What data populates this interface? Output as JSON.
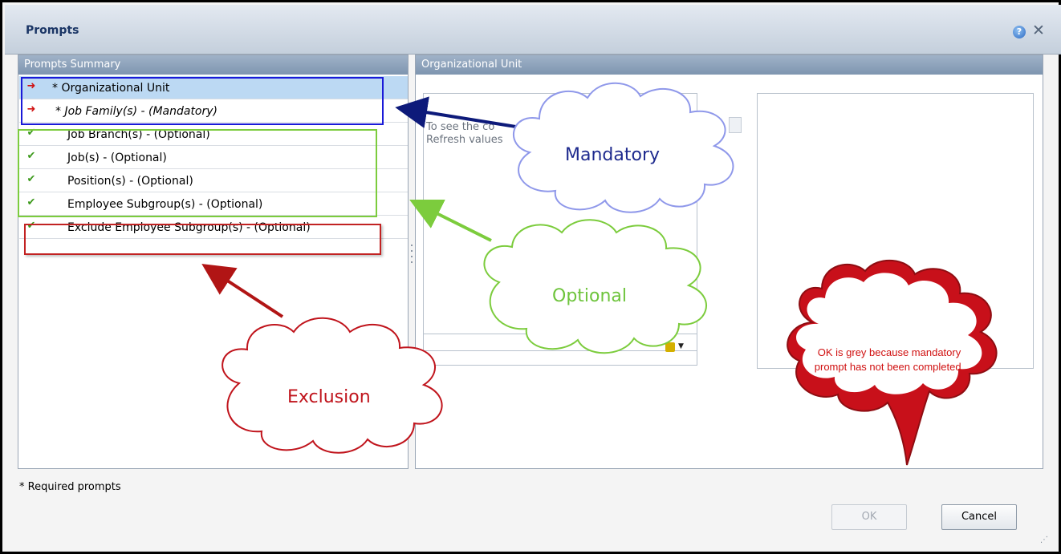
{
  "window": {
    "title": "Prompts",
    "help_icon": "help-icon",
    "close_icon": "close-icon"
  },
  "summary_panel": {
    "header": "Prompts Summary",
    "rows": [
      {
        "label": "* Organizational Unit",
        "status_icon": "arrow-icon",
        "italic": false,
        "selected": true
      },
      {
        "label": "* Job Family(s) - (Mandatory)",
        "status_icon": "arrow-icon",
        "italic": true,
        "selected": false
      },
      {
        "label": "Job Branch(s) - (Optional)",
        "status_icon": "check-icon",
        "italic": false,
        "selected": false
      },
      {
        "label": "Job(s) - (Optional)",
        "status_icon": "check-icon",
        "italic": false,
        "selected": false
      },
      {
        "label": "Position(s) - (Optional)",
        "status_icon": "check-icon",
        "italic": false,
        "selected": false
      },
      {
        "label": "Employee Subgroup(s) - (Optional)",
        "status_icon": "check-icon",
        "italic": false,
        "selected": false
      },
      {
        "label": "Exclude Employee Subgroup(s) - (Optional)",
        "status_icon": "check-icon",
        "italic": false,
        "selected": false
      }
    ]
  },
  "org_panel": {
    "header": "Organizational Unit",
    "list_text_line1": "To see the co",
    "list_text_line2": "Refresh values"
  },
  "footer": {
    "required_note": "* Required prompts",
    "ok_label": "OK",
    "cancel_label": "Cancel"
  },
  "annotations": {
    "mandatory": "Mandatory",
    "optional": "Optional",
    "exclusion": "Exclusion",
    "bubble": "OK is grey because mandatory prompt has not been completed.",
    "colors": {
      "mandatory": "#1e2a8e",
      "optional": "#6ec43c",
      "exclusion": "#c0141c",
      "bubble_fill": "#c8101a"
    }
  }
}
